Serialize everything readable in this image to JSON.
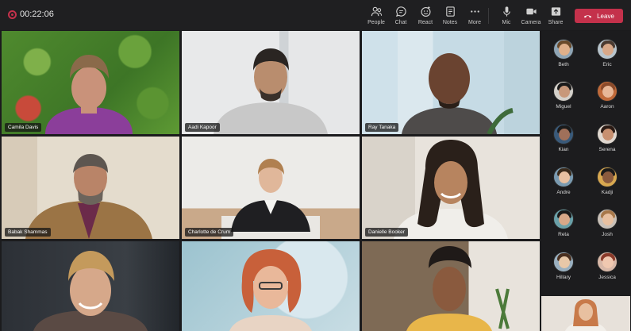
{
  "meeting": {
    "elapsed": "00:22:06"
  },
  "toolbar": {
    "people": "People",
    "chat": "Chat",
    "react": "React",
    "notes": "Notes",
    "more": "More",
    "mic": "Mic",
    "camera": "Camera",
    "share": "Share",
    "leave": "Leave"
  },
  "tiles": [
    {
      "name": "Camila Davis"
    },
    {
      "name": "Aadi Kapoor"
    },
    {
      "name": "Ray Tanaka"
    },
    {
      "name": "Babak Shammas"
    },
    {
      "name": "Charlotte de Crum"
    },
    {
      "name": "Danielle Booker"
    }
  ],
  "roster": [
    {
      "name": "Beth"
    },
    {
      "name": "Eric"
    },
    {
      "name": "Miguel"
    },
    {
      "name": "Aaron"
    },
    {
      "name": "Kian"
    },
    {
      "name": "Serena"
    },
    {
      "name": "Andre"
    },
    {
      "name": "Kadji"
    },
    {
      "name": "Reta"
    },
    {
      "name": "Josh"
    },
    {
      "name": "Hillary"
    },
    {
      "name": "Jessica"
    }
  ],
  "colors": {
    "leave": "#c4314b",
    "background": "#1b1b1d"
  }
}
